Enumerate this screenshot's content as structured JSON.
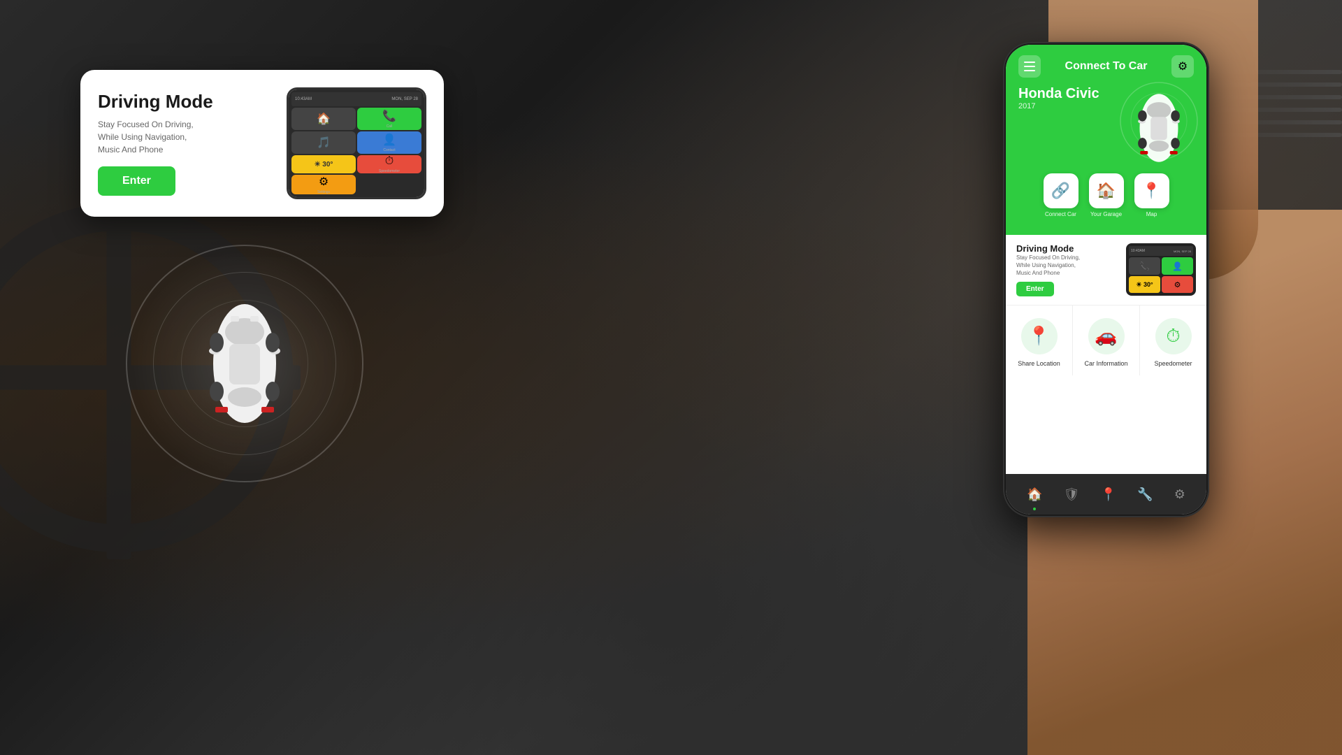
{
  "app": {
    "title": "Connect To Car"
  },
  "driving_mode_card": {
    "title": "Driving Mode",
    "description": "Stay Focused On Driving,\nWhile Using Navigation,\nMusic And Phone",
    "enter_label": "Enter"
  },
  "car": {
    "make": "Honda Civic",
    "year": "2017"
  },
  "quick_actions": [
    {
      "id": "connect-car",
      "label": "Connect Car",
      "icon": "🔗"
    },
    {
      "id": "your-garage",
      "label": "Your Garage",
      "icon": "🏠"
    },
    {
      "id": "map",
      "label": "Map",
      "icon": "📍"
    }
  ],
  "features": [
    {
      "id": "share-location",
      "label": "Share Location",
      "icon": "📍"
    },
    {
      "id": "car-information",
      "label": "Car Information",
      "icon": "🚗"
    },
    {
      "id": "speedometer",
      "label": "Speedometer",
      "icon": "⏱"
    }
  ],
  "nav_items": [
    {
      "id": "home",
      "icon": "🏠",
      "active": true
    },
    {
      "id": "shield",
      "icon": "🛡",
      "active": false
    },
    {
      "id": "location",
      "icon": "📍",
      "active": false
    },
    {
      "id": "tools",
      "icon": "🔧",
      "active": false
    },
    {
      "id": "settings",
      "icon": "⚙",
      "active": false
    }
  ],
  "mini_weather": {
    "condition": "Sunny",
    "temp": "30°"
  },
  "colors": {
    "green": "#2ecc40",
    "dark": "#1a1a1a",
    "white": "#ffffff"
  }
}
